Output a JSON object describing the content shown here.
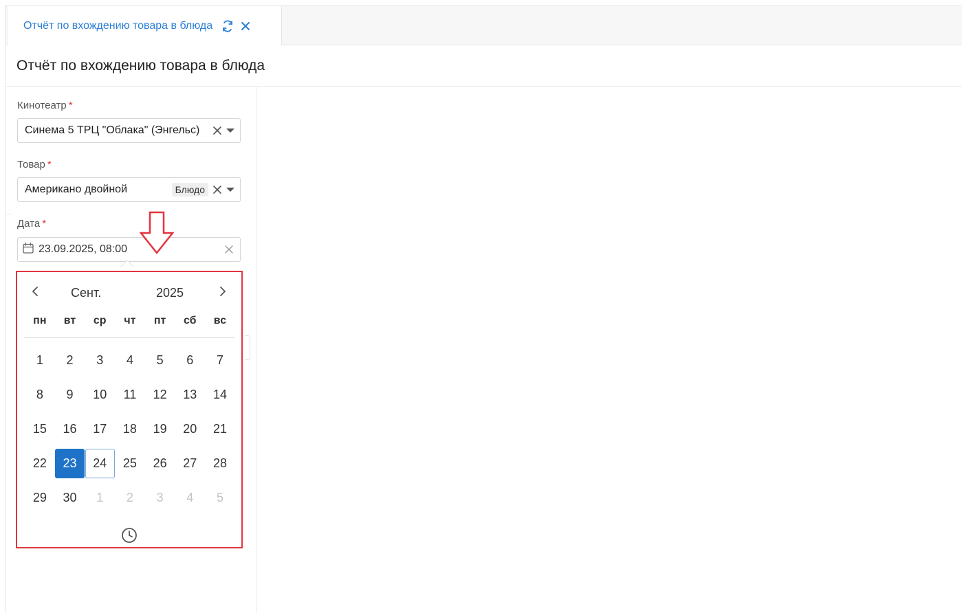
{
  "tab": {
    "title": "Отчёт по вхождению товара в блюда"
  },
  "page": {
    "title": "Отчёт по вхождению товара в блюда"
  },
  "form": {
    "cinema": {
      "label": "Кинотеатр",
      "required_mark": "*",
      "value": "Синема 5 ТРЦ \"Облака\" (Энгельс)"
    },
    "product": {
      "label": "Товар",
      "required_mark": "*",
      "value": "Американо двойной",
      "tag": "Блюдо"
    },
    "date": {
      "label": "Дата",
      "required_mark": "*",
      "value": "23.09.2025, 08:00"
    }
  },
  "calendar": {
    "month": "Сент.",
    "year": "2025",
    "weekdays": [
      "пн",
      "вт",
      "ср",
      "чт",
      "пт",
      "сб",
      "вс"
    ],
    "days": [
      {
        "label": "1"
      },
      {
        "label": "2"
      },
      {
        "label": "3"
      },
      {
        "label": "4"
      },
      {
        "label": "5"
      },
      {
        "label": "6"
      },
      {
        "label": "7"
      },
      {
        "label": "8"
      },
      {
        "label": "9"
      },
      {
        "label": "10"
      },
      {
        "label": "11"
      },
      {
        "label": "12"
      },
      {
        "label": "13"
      },
      {
        "label": "14"
      },
      {
        "label": "15"
      },
      {
        "label": "16"
      },
      {
        "label": "17"
      },
      {
        "label": "18"
      },
      {
        "label": "19"
      },
      {
        "label": "20"
      },
      {
        "label": "21"
      },
      {
        "label": "22"
      },
      {
        "label": "23",
        "state": "selected"
      },
      {
        "label": "24",
        "state": "today"
      },
      {
        "label": "25"
      },
      {
        "label": "26"
      },
      {
        "label": "27"
      },
      {
        "label": "28"
      },
      {
        "label": "29"
      },
      {
        "label": "30"
      },
      {
        "label": "1",
        "state": "muted"
      },
      {
        "label": "2",
        "state": "muted"
      },
      {
        "label": "3",
        "state": "muted"
      },
      {
        "label": "4",
        "state": "muted"
      },
      {
        "label": "5",
        "state": "muted"
      }
    ]
  },
  "colors": {
    "accent": "#2b7fd6",
    "selected": "#1e73c9",
    "highlight_frame": "#e2353f",
    "required": "#e03a3a"
  },
  "icons": {
    "refresh": "refresh-icon",
    "close": "close-icon",
    "calendar": "calendar-icon",
    "clock": "clock-icon",
    "annotation": "arrow-down-icon"
  }
}
